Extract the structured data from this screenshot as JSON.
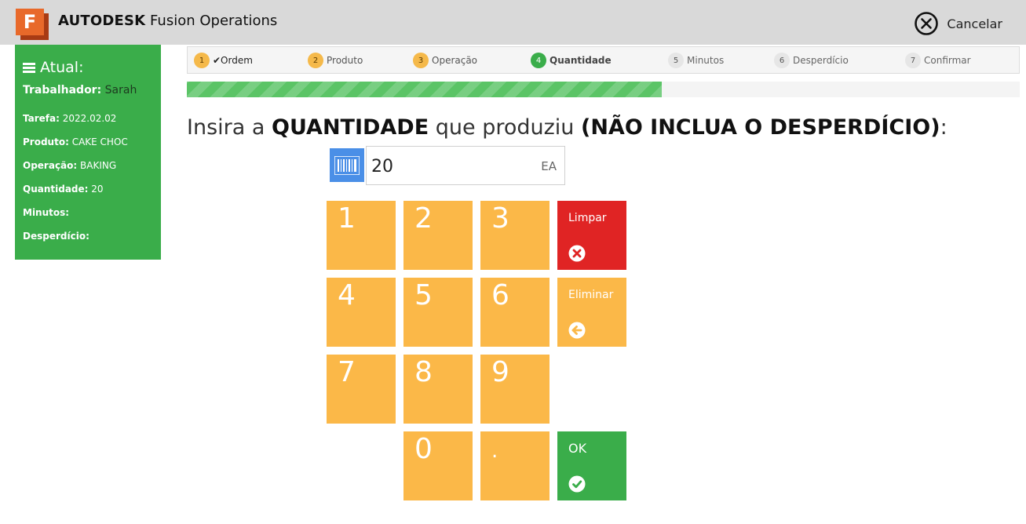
{
  "header": {
    "brand_bold": "AUTODESK",
    "brand_rest": " Fusion Operations",
    "logo_letter": "F",
    "cancel_label": "Cancelar"
  },
  "sidebar": {
    "title": "Atual:",
    "worker_label": "Trabalhador:",
    "worker_value": " Sarah",
    "rows": [
      {
        "label": "Tarefa:",
        "value": " 2022.02.02"
      },
      {
        "label": "Produto:",
        "value": " CAKE CHOC"
      },
      {
        "label": "Operação:",
        "value": " BAKING"
      },
      {
        "label": "Quantidade:",
        "value": " 20"
      },
      {
        "label": "Minutos:",
        "value": ""
      },
      {
        "label": "Desperdício:",
        "value": ""
      }
    ]
  },
  "steps": [
    {
      "num": "1",
      "label": "✔Ordem",
      "state": "done"
    },
    {
      "num": "2",
      "label": "Produto",
      "state": "done"
    },
    {
      "num": "3",
      "label": "Operação",
      "state": "done"
    },
    {
      "num": "4",
      "label": "Quantidade",
      "state": "active"
    },
    {
      "num": "5",
      "label": "Minutos",
      "state": "pending"
    },
    {
      "num": "6",
      "label": "Desperdício",
      "state": "pending"
    },
    {
      "num": "7",
      "label": "Confirmar",
      "state": "pending"
    }
  ],
  "progress": {
    "fraction": 0.57
  },
  "instruction": {
    "part1": "Insira a ",
    "part2": "QUANTIDADE",
    "part3": " que produziu ",
    "part4": "(NÃO INCLUA O DESPERDÍCIO)",
    "part5": ":"
  },
  "quantity": {
    "value": "20",
    "unit": "EA"
  },
  "keypad": {
    "digits": [
      "1",
      "2",
      "3",
      "4",
      "5",
      "6",
      "7",
      "8",
      "9",
      "0",
      "."
    ],
    "clear_label": "Limpar",
    "delete_label": "Eliminar",
    "ok_label": "OK"
  },
  "colors": {
    "accent_green": "#3aad4a",
    "key_orange": "#fbb848",
    "clear_red": "#e02424",
    "barcode_blue": "#4a8fe7"
  }
}
